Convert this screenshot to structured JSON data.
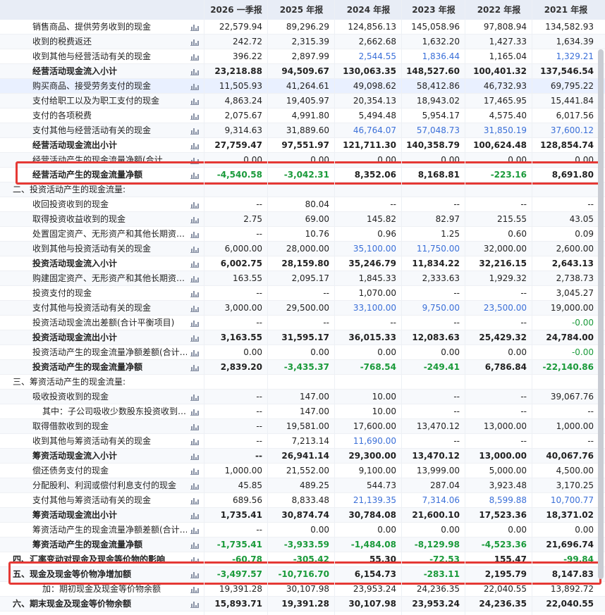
{
  "header": [
    "2026 一季报",
    "2025 年报",
    "2024 年报",
    "2023 年报",
    "2022 年报",
    "2021 年报"
  ],
  "rows": [
    {
      "label": "销售商品、提供劳务收到的现金",
      "indent": 1,
      "chart": true,
      "values": [
        "22,579.94",
        "89,296.29",
        "124,856.13",
        "145,058.96",
        "97,808.94",
        "134,582.93"
      ]
    },
    {
      "label": "收到的税费返还",
      "indent": 1,
      "chart": true,
      "values": [
        "242.72",
        "2,315.39",
        "2,662.68",
        "1,632.20",
        "1,427.33",
        "1,634.39"
      ]
    },
    {
      "label": "收到其他与经营活动有关的现金",
      "indent": 1,
      "chart": true,
      "values": [
        "396.22",
        "2,897.99",
        "2,544.55",
        "1,836.44",
        "1,165.04",
        "1,329.21"
      ],
      "link": [
        2,
        3,
        5
      ]
    },
    {
      "label": "经营活动现金流入小计",
      "indent": 1,
      "bold": true,
      "chart": true,
      "values": [
        "23,218.88",
        "94,509.67",
        "130,063.35",
        "148,527.60",
        "100,401.32",
        "137,546.54"
      ]
    },
    {
      "label": "购买商品、接受劳务支付的现金",
      "indent": 1,
      "chart": true,
      "hl": true,
      "values": [
        "11,505.93",
        "41,264.61",
        "49,098.62",
        "58,412.86",
        "46,732.93",
        "69,795.22"
      ]
    },
    {
      "label": "支付给职工以及为职工支付的现金",
      "indent": 1,
      "chart": true,
      "values": [
        "4,863.24",
        "19,405.97",
        "20,354.13",
        "18,943.02",
        "17,465.95",
        "15,441.84"
      ]
    },
    {
      "label": "支付的各项税费",
      "indent": 1,
      "chart": true,
      "values": [
        "2,075.67",
        "4,991.80",
        "5,494.48",
        "5,954.17",
        "4,575.40",
        "6,017.56"
      ]
    },
    {
      "label": "支付其他与经营活动有关的现金",
      "indent": 1,
      "chart": true,
      "values": [
        "9,314.63",
        "31,889.60",
        "46,764.07",
        "57,048.73",
        "31,850.19",
        "37,600.12"
      ],
      "link": [
        2,
        3,
        4,
        5
      ]
    },
    {
      "label": "经营活动现金流出小计",
      "indent": 1,
      "bold": true,
      "chart": true,
      "values": [
        "27,759.47",
        "97,551.97",
        "121,711.30",
        "140,358.79",
        "100,624.48",
        "128,854.74"
      ]
    },
    {
      "label": "经营活动产生的现金流量净额(合计…",
      "indent": 1,
      "chart": true,
      "clip": true,
      "values": [
        "0.00",
        "0.00",
        "0.00",
        "0.00",
        "0.00",
        "0.00"
      ]
    },
    {
      "label": "经营活动产生的现金流量净额",
      "indent": 1,
      "bold": true,
      "chart": true,
      "values": [
        "-4,540.58",
        "-3,042.31",
        "8,352.06",
        "8,168.81",
        "-223.16",
        "8,691.80"
      ],
      "neg": [
        0,
        1,
        4
      ]
    },
    {
      "label": "二、投资活动产生的现金流量:",
      "indent": 0,
      "values": [
        "",
        "",
        "",
        "",
        "",
        ""
      ]
    },
    {
      "label": "收回投资收到的现金",
      "indent": 1,
      "chart": true,
      "values": [
        "--",
        "80.04",
        "--",
        "--",
        "--",
        "--"
      ]
    },
    {
      "label": "取得投资收益收到的现金",
      "indent": 1,
      "chart": true,
      "values": [
        "2.75",
        "69.00",
        "145.82",
        "82.97",
        "215.55",
        "43.05"
      ]
    },
    {
      "label": "处置固定资产、无形资产和其他长期资…",
      "indent": 1,
      "chart": true,
      "values": [
        "--",
        "10.76",
        "0.96",
        "1.25",
        "0.60",
        "0.09"
      ]
    },
    {
      "label": "收到其他与投资活动有关的现金",
      "indent": 1,
      "chart": true,
      "values": [
        "6,000.00",
        "28,000.00",
        "35,100.00",
        "11,750.00",
        "32,000.00",
        "2,600.00"
      ],
      "link": [
        2,
        3
      ]
    },
    {
      "label": "投资活动现金流入小计",
      "indent": 1,
      "bold": true,
      "chart": true,
      "values": [
        "6,002.75",
        "28,159.80",
        "35,246.79",
        "11,834.22",
        "32,216.15",
        "2,643.13"
      ]
    },
    {
      "label": "购建固定资产、无形资产和其他长期资…",
      "indent": 1,
      "chart": true,
      "values": [
        "163.55",
        "2,095.17",
        "1,845.33",
        "2,333.63",
        "1,929.32",
        "2,738.73"
      ]
    },
    {
      "label": "投资支付的现金",
      "indent": 1,
      "chart": true,
      "values": [
        "--",
        "--",
        "1,070.00",
        "--",
        "--",
        "3,045.27"
      ]
    },
    {
      "label": "支付其他与投资活动有关的现金",
      "indent": 1,
      "chart": true,
      "values": [
        "3,000.00",
        "29,500.00",
        "33,100.00",
        "9,750.00",
        "23,500.00",
        "19,000.00"
      ],
      "link": [
        2,
        3,
        4
      ]
    },
    {
      "label": "投资活动现金流出差额(合计平衡项目)",
      "indent": 1,
      "chart": true,
      "values": [
        "--",
        "--",
        "--",
        "--",
        "--",
        "-0.00"
      ],
      "neg": [
        5
      ]
    },
    {
      "label": "投资活动现金流出小计",
      "indent": 1,
      "bold": true,
      "chart": true,
      "values": [
        "3,163.55",
        "31,595.17",
        "36,015.33",
        "12,083.63",
        "25,429.32",
        "24,784.00"
      ]
    },
    {
      "label": "投资活动产生的现金流量净额差额(合计…",
      "indent": 1,
      "chart": true,
      "values": [
        "0.00",
        "0.00",
        "0.00",
        "0.00",
        "0.00",
        "-0.00"
      ],
      "neg": [
        5
      ]
    },
    {
      "label": "投资活动产生的现金流量净额",
      "indent": 1,
      "bold": true,
      "chart": true,
      "values": [
        "2,839.20",
        "-3,435.37",
        "-768.54",
        "-249.41",
        "6,786.84",
        "-22,140.86"
      ],
      "neg": [
        1,
        2,
        3,
        5
      ]
    },
    {
      "label": "三、筹资活动产生的现金流量:",
      "indent": 0,
      "values": [
        "",
        "",
        "",
        "",
        "",
        ""
      ]
    },
    {
      "label": "吸收投资收到的现金",
      "indent": 1,
      "chart": true,
      "values": [
        "--",
        "147.00",
        "10.00",
        "--",
        "--",
        "39,067.76"
      ]
    },
    {
      "label": "其中：子公司吸收少数股东投资收到…",
      "indent": 2,
      "chart": true,
      "values": [
        "--",
        "147.00",
        "10.00",
        "--",
        "--",
        "--"
      ]
    },
    {
      "label": "取得借款收到的现金",
      "indent": 1,
      "chart": true,
      "values": [
        "--",
        "19,581.00",
        "17,600.00",
        "13,470.12",
        "13,000.00",
        "1,000.00"
      ]
    },
    {
      "label": "收到其他与筹资活动有关的现金",
      "indent": 1,
      "chart": true,
      "values": [
        "--",
        "7,213.14",
        "11,690.00",
        "--",
        "--",
        "--"
      ],
      "link": [
        2
      ]
    },
    {
      "label": "筹资活动现金流入小计",
      "indent": 1,
      "bold": true,
      "chart": true,
      "values": [
        "--",
        "26,941.14",
        "29,300.00",
        "13,470.12",
        "13,000.00",
        "40,067.76"
      ]
    },
    {
      "label": "偿还债务支付的现金",
      "indent": 1,
      "chart": true,
      "values": [
        "1,000.00",
        "21,552.00",
        "9,100.00",
        "13,999.00",
        "5,000.00",
        "4,500.00"
      ]
    },
    {
      "label": "分配股利、利润或偿付利息支付的现金",
      "indent": 1,
      "chart": true,
      "values": [
        "45.85",
        "489.25",
        "544.73",
        "287.04",
        "3,923.48",
        "3,170.25"
      ]
    },
    {
      "label": "支付其他与筹资活动有关的现金",
      "indent": 1,
      "chart": true,
      "values": [
        "689.56",
        "8,833.48",
        "21,139.35",
        "7,314.06",
        "8,599.88",
        "10,700.77"
      ],
      "link": [
        2,
        3,
        4,
        5
      ]
    },
    {
      "label": "筹资活动现金流出小计",
      "indent": 1,
      "bold": true,
      "chart": true,
      "values": [
        "1,735.41",
        "30,874.74",
        "30,784.08",
        "21,600.10",
        "17,523.36",
        "18,371.02"
      ]
    },
    {
      "label": "筹资活动产生的现金流量净额差额(合计…",
      "indent": 1,
      "chart": true,
      "values": [
        "--",
        "0.00",
        "0.00",
        "0.00",
        "0.00",
        "0.00"
      ]
    },
    {
      "label": "筹资活动产生的现金流量净额",
      "indent": 1,
      "bold": true,
      "chart": true,
      "values": [
        "-1,735.41",
        "-3,933.59",
        "-1,484.08",
        "-8,129.98",
        "-4,523.36",
        "21,696.74"
      ],
      "neg": [
        0,
        1,
        2,
        3,
        4
      ]
    },
    {
      "label": "四、汇率变动对现金及现金等价物的影响",
      "indent": 0,
      "bold": true,
      "chart": true,
      "clip": true,
      "values": [
        "-60.78",
        "-305.42",
        "55.30",
        "-72.53",
        "155.47",
        "-99.84"
      ],
      "neg": [
        0,
        1,
        3,
        5
      ]
    },
    {
      "label": "五、现金及现金等价物净增加额",
      "indent": 0,
      "bold": true,
      "chart": true,
      "values": [
        "-3,497.57",
        "-10,716.70",
        "6,154.73",
        "-283.11",
        "2,195.79",
        "8,147.83"
      ],
      "neg": [
        0,
        1,
        3
      ]
    },
    {
      "label": "加：期初现金及现金等价物余额",
      "indent": 2,
      "chart": true,
      "values": [
        "19,391.28",
        "30,107.98",
        "23,953.24",
        "24,236.35",
        "22,040.55",
        "13,892.72"
      ]
    },
    {
      "label": "六、期末现金及现金等价物余额",
      "indent": 0,
      "bold": true,
      "chart": true,
      "values": [
        "15,893.71",
        "19,391.28",
        "30,107.98",
        "23,953.24",
        "24,236.35",
        "22,040.55"
      ]
    }
  ],
  "colors": {
    "negative": "#1a9a3a",
    "link": "#3a6fd8",
    "highlight_box": "#e53935",
    "header_bg": "#e8edf6"
  }
}
